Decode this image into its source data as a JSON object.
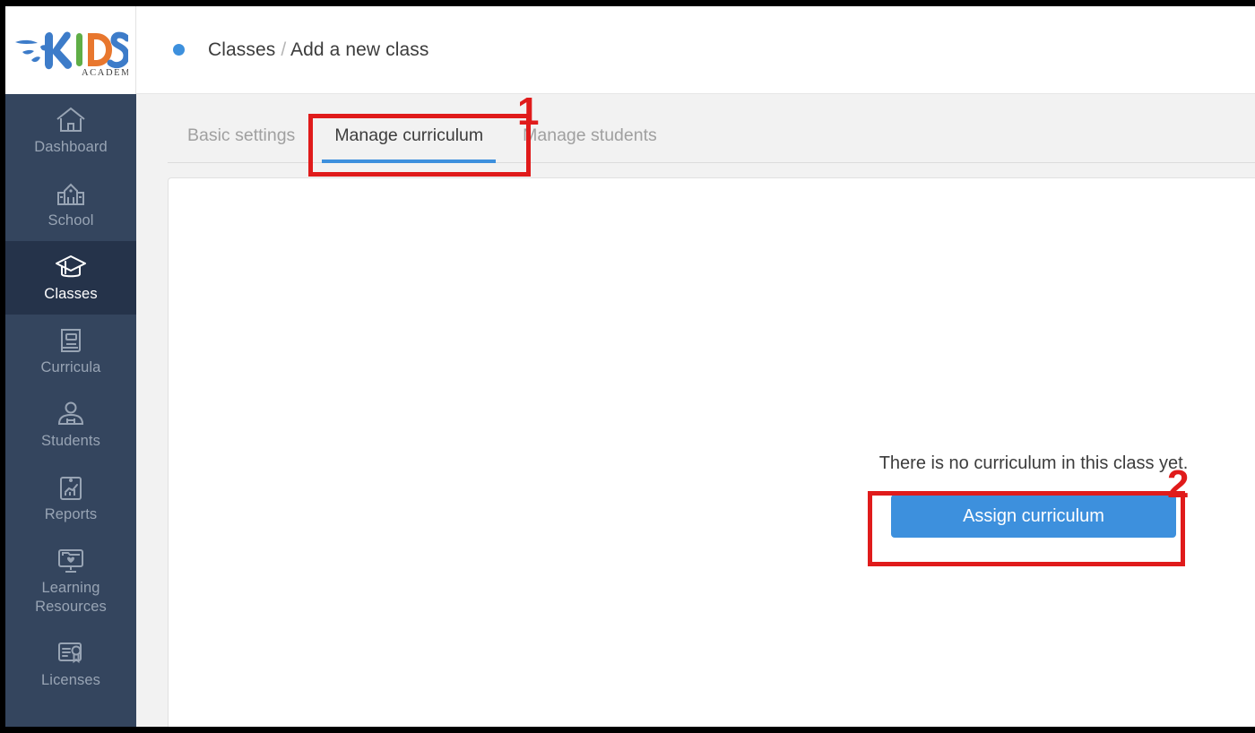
{
  "brand": {
    "name": "KIDS ACADEMY",
    "word": "KIDS",
    "subtitle": "ACADEMY",
    "colors": {
      "blue": "#3d7cc9",
      "green": "#5fae46",
      "orange": "#e8772e",
      "dark": "#3c3c3c"
    }
  },
  "sidebar": {
    "background": "#34455e",
    "active_background": "#25334a",
    "items": [
      {
        "label": "Dashboard",
        "icon": "home-icon",
        "active": false
      },
      {
        "label": "School",
        "icon": "school-building-icon",
        "active": false
      },
      {
        "label": "Classes",
        "icon": "graduation-cap-icon",
        "active": true
      },
      {
        "label": "Curricula",
        "icon": "book-icon",
        "active": false
      },
      {
        "label": "Students",
        "icon": "students-group-icon",
        "active": false
      },
      {
        "label": "Reports",
        "icon": "reports-chart-icon",
        "active": false
      },
      {
        "label": "Learning Resources",
        "icon": "monitor-folder-icon",
        "active": false
      },
      {
        "label": "Licenses",
        "icon": "certificate-icon",
        "active": false
      }
    ]
  },
  "header": {
    "breadcrumb": {
      "dot_color": "#3d90dd",
      "root": "Classes",
      "separator": "/",
      "current": "Add a new class"
    }
  },
  "tabs": [
    {
      "label": "Basic settings",
      "active": false
    },
    {
      "label": "Manage curriculum",
      "active": true
    },
    {
      "label": "Manage students",
      "active": false
    }
  ],
  "content": {
    "empty_state_text": "There is no curriculum in this class yet.",
    "assign_button_label": "Assign curriculum",
    "assign_button_color": "#3d90dd"
  },
  "annotations": {
    "color": "#e01b1b",
    "steps": [
      {
        "number": "1",
        "target": "Manage curriculum tab"
      },
      {
        "number": "2",
        "target": "Assign curriculum button"
      }
    ]
  }
}
